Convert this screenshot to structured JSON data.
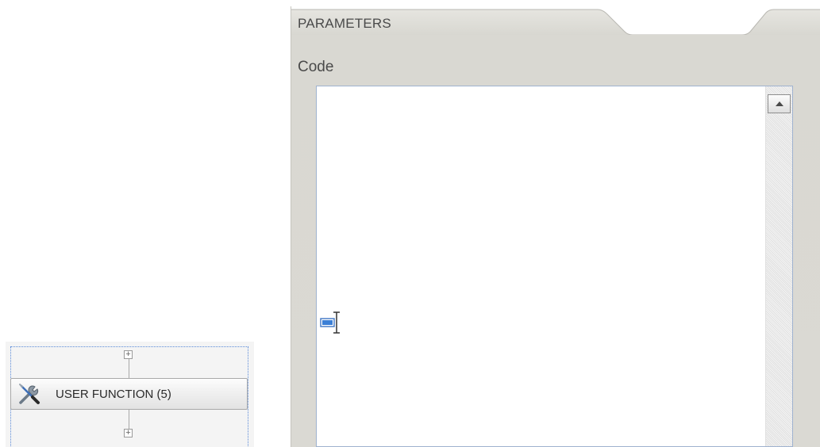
{
  "workflow_node": {
    "label": "USER FUNCTION (5)",
    "icon": "tools-icon",
    "top_connector": "+",
    "bottom_connector": "+"
  },
  "panel": {
    "title": "PARAMETERS",
    "header_icons": [
      "lightning-icon",
      "save-icon"
    ],
    "code_label": "Code",
    "editor_value": ""
  },
  "colors": {
    "panel_bg": "#dad9d3",
    "selection_border": "#5a8ad8",
    "editor_border": "#9fb2cf"
  }
}
